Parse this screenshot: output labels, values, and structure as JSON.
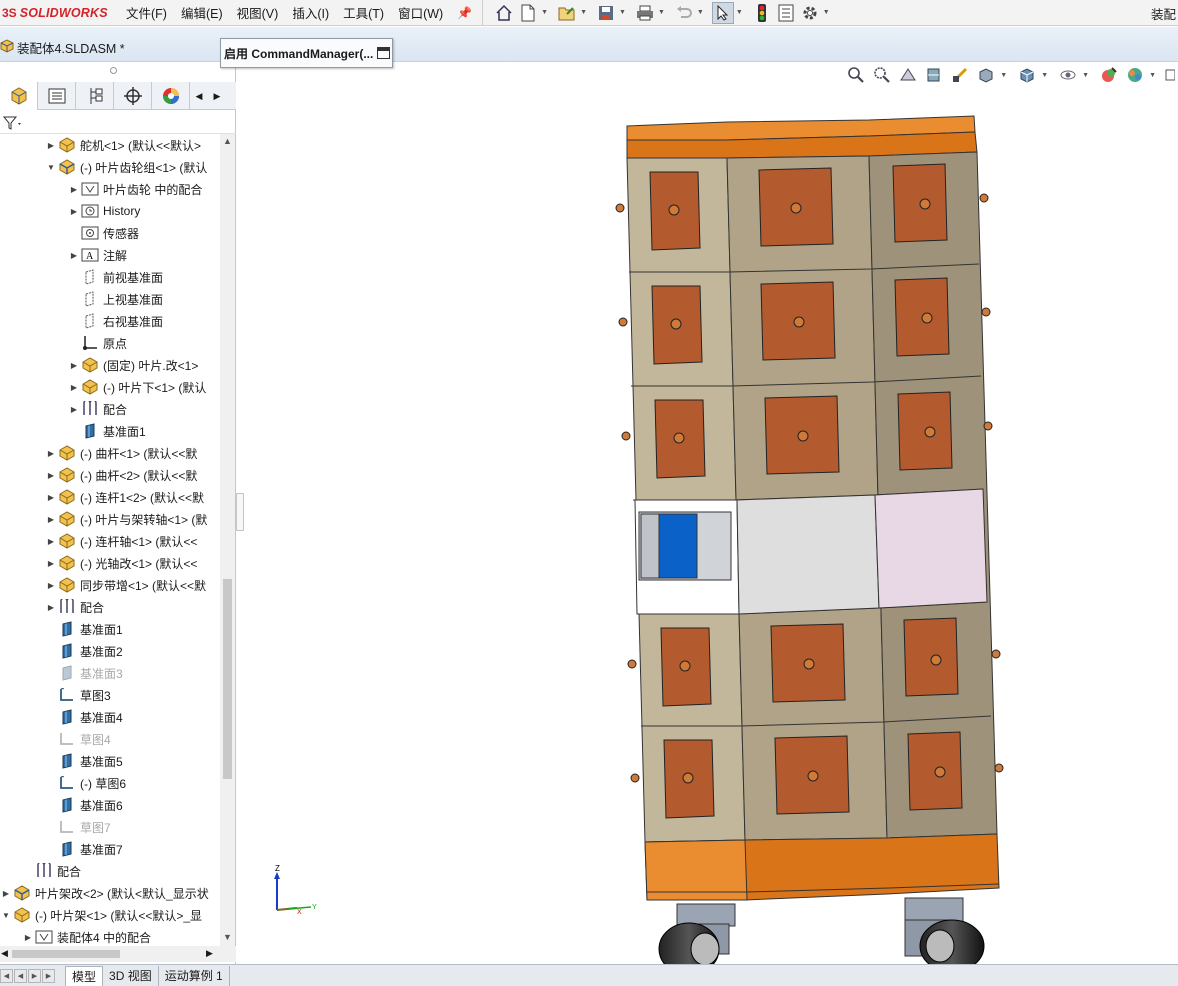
{
  "app": {
    "brand_ds": "3S",
    "brand": "SOLIDWORKS",
    "right_title": "装配"
  },
  "menus": [
    {
      "label": "文件(F)"
    },
    {
      "label": "编辑(E)"
    },
    {
      "label": "视图(V)"
    },
    {
      "label": "插入(I)"
    },
    {
      "label": "工具(T)"
    },
    {
      "label": "窗口(W)"
    }
  ],
  "document": {
    "title": "装配体4.SLDASM *",
    "command_manager": "启用 CommandManager(..."
  },
  "tree": [
    {
      "label": "舵机<1> (默认<<默认>",
      "indent": 1,
      "icon": "part",
      "exp": "right"
    },
    {
      "label": "(-) 叶片齿轮组<1> (默认",
      "indent": 1,
      "icon": "subasm",
      "exp": "down"
    },
    {
      "label": "叶片齿轮 中的配合",
      "indent": 2,
      "icon": "mates-folder",
      "exp": "right"
    },
    {
      "label": "History",
      "indent": 2,
      "icon": "history",
      "exp": "right"
    },
    {
      "label": "传感器",
      "indent": 2,
      "icon": "sensor",
      "exp": ""
    },
    {
      "label": "注解",
      "indent": 2,
      "icon": "annotation",
      "exp": "right"
    },
    {
      "label": "前视基准面",
      "indent": 2,
      "icon": "plane-outline",
      "exp": ""
    },
    {
      "label": "上视基准面",
      "indent": 2,
      "icon": "plane-outline",
      "exp": ""
    },
    {
      "label": "右视基准面",
      "indent": 2,
      "icon": "plane-outline",
      "exp": ""
    },
    {
      "label": "原点",
      "indent": 2,
      "icon": "origin",
      "exp": ""
    },
    {
      "label": "(固定) 叶片.改<1>",
      "indent": 2,
      "icon": "part",
      "exp": "right"
    },
    {
      "label": "(-) 叶片下<1> (默认",
      "indent": 2,
      "icon": "part",
      "exp": "right"
    },
    {
      "label": "配合",
      "indent": 2,
      "icon": "mate",
      "exp": "right"
    },
    {
      "label": "基准面1",
      "indent": 2,
      "icon": "plane",
      "exp": ""
    },
    {
      "label": "(-) 曲杆<1> (默认<<默",
      "indent": 1,
      "icon": "part",
      "exp": "right"
    },
    {
      "label": "(-) 曲杆<2> (默认<<默",
      "indent": 1,
      "icon": "part",
      "exp": "right"
    },
    {
      "label": "(-) 连杆1<2> (默认<<默",
      "indent": 1,
      "icon": "part",
      "exp": "right"
    },
    {
      "label": "(-) 叶片与架转轴<1> (默",
      "indent": 1,
      "icon": "part",
      "exp": "right"
    },
    {
      "label": "(-) 连杆轴<1> (默认<<",
      "indent": 1,
      "icon": "part",
      "exp": "right"
    },
    {
      "label": "(-) 光轴改<1> (默认<<",
      "indent": 1,
      "icon": "part",
      "exp": "right"
    },
    {
      "label": "同步带增<1> (默认<<默",
      "indent": 1,
      "icon": "part",
      "exp": "right"
    },
    {
      "label": "配合",
      "indent": 1,
      "icon": "mate",
      "exp": "right"
    },
    {
      "label": "基准面1",
      "indent": 1,
      "icon": "plane",
      "exp": ""
    },
    {
      "label": "基准面2",
      "indent": 1,
      "icon": "plane",
      "exp": ""
    },
    {
      "label": "基准面3",
      "indent": 1,
      "icon": "plane-dim",
      "exp": "",
      "dim": true
    },
    {
      "label": "草图3",
      "indent": 1,
      "icon": "sketch",
      "exp": ""
    },
    {
      "label": "基准面4",
      "indent": 1,
      "icon": "plane",
      "exp": ""
    },
    {
      "label": "草图4",
      "indent": 1,
      "icon": "sketch-dim",
      "exp": "",
      "dim": true
    },
    {
      "label": "基准面5",
      "indent": 1,
      "icon": "plane",
      "exp": ""
    },
    {
      "label": "(-) 草图6",
      "indent": 1,
      "icon": "sketch",
      "exp": ""
    },
    {
      "label": "基准面6",
      "indent": 1,
      "icon": "plane",
      "exp": ""
    },
    {
      "label": "草图7",
      "indent": 1,
      "icon": "sketch-dim",
      "exp": "",
      "dim": true
    },
    {
      "label": "基准面7",
      "indent": 1,
      "icon": "plane",
      "exp": ""
    },
    {
      "label": "配合",
      "indent": 0,
      "icon": "mate",
      "exp": ""
    },
    {
      "label": "叶片架改<2> (默认<默认_显示状",
      "indent": -1,
      "icon": "subasm",
      "exp": "right"
    },
    {
      "label": "(-) 叶片架<1> (默认<<默认>_显",
      "indent": -1,
      "icon": "part",
      "exp": "down"
    },
    {
      "label": "装配体4 中的配合",
      "indent": 0,
      "icon": "mates-folder",
      "exp": "right"
    }
  ],
  "bottom_tabs": [
    {
      "label": "模型",
      "active": true
    },
    {
      "label": "3D 视图",
      "active": false
    },
    {
      "label": "运动算例 1",
      "active": false
    }
  ],
  "triad": {
    "x": "X",
    "y": "Y",
    "z": "Z"
  },
  "colors": {
    "accent_red": "#d2232a",
    "panel_bg": "#ffffff",
    "tab_bg": "#eef2f7",
    "door_orange": "#b35a2e",
    "frame_tan": "#c2b79b",
    "trim_orange": "#e6801e"
  }
}
